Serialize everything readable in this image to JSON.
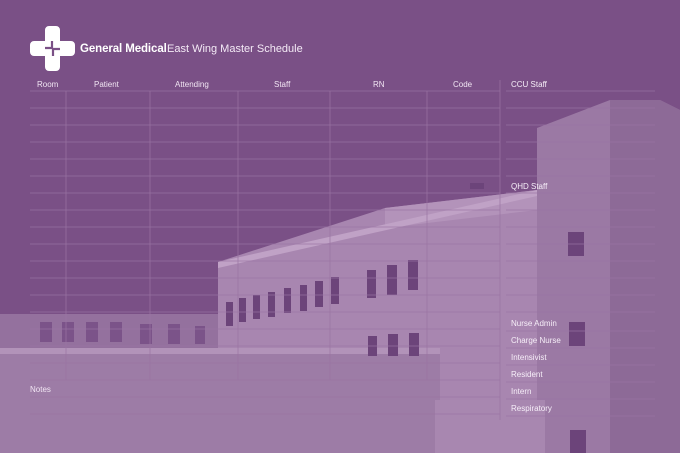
{
  "header": {
    "brand_name": "General Medical",
    "board_title": "East Wing Master Schedule"
  },
  "table": {
    "columns": [
      "Room",
      "Patient",
      "Attending",
      "Staff",
      "RN",
      "Code"
    ]
  },
  "side_panel": {
    "ccu_label": "CCU Staff",
    "qhd_label": "QHD Staff",
    "roles": [
      "Nurse Admin",
      "Charge Nurse",
      "Intensivist",
      "Resident",
      "Intern",
      "Respiratory"
    ]
  },
  "notes": {
    "label": "Notes"
  },
  "colors": {
    "background": "#7a5086",
    "building": "#a886b0",
    "grid_line": "#9a74a3",
    "text": "#f1e6f3"
  },
  "icons": {
    "logo": "medical-cross-icon"
  }
}
